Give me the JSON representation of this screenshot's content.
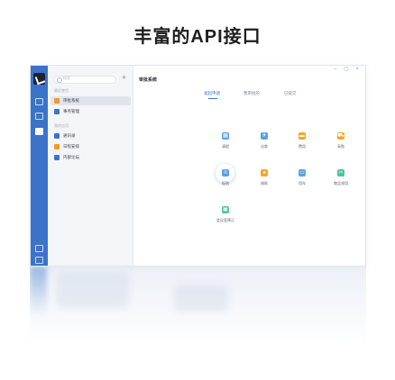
{
  "headline": "丰富的API接口",
  "sidebar": {
    "search_placeholder": "搜索",
    "add_label": "+",
    "group1_label": "最近使用",
    "group1_items": [
      {
        "label": "审批系统",
        "color": "#f29b1d",
        "active": true
      },
      {
        "label": "事务管理",
        "color": "#3b73c9",
        "active": false
      }
    ],
    "group2_label": "我的应用",
    "group2_items": [
      {
        "label": "通讯录",
        "color": "#3b73c9"
      },
      {
        "label": "日程安排",
        "color": "#f29b1d"
      },
      {
        "label": "内部论坛",
        "color": "#3b73c9"
      }
    ]
  },
  "main": {
    "title": "审批系统",
    "window_controls": "– ▢ ×",
    "tabs": [
      {
        "label": "发起申请",
        "active": true
      },
      {
        "label": "我审批的",
        "active": false
      },
      {
        "label": "已提交",
        "active": false
      }
    ],
    "apps": [
      {
        "label": "请假",
        "icon": "calendar-icon",
        "glyph": "▦",
        "color": "#5aa0e8"
      },
      {
        "label": "出差",
        "icon": "plane-icon",
        "glyph": "✈",
        "color": "#5aa0e8"
      },
      {
        "label": "费用",
        "icon": "wallet-icon",
        "glyph": "▬",
        "color": "#f5a623"
      },
      {
        "label": "采购",
        "icon": "cart-icon",
        "glyph": "⛟",
        "color": "#f5a623"
      },
      {
        "label": "报销",
        "icon": "receipt-icon",
        "glyph": "≡",
        "color": "#5aa0e8",
        "highlight": true
      },
      {
        "label": "借款",
        "icon": "coin-icon",
        "glyph": "●",
        "color": "#f5a623"
      },
      {
        "label": "用车",
        "icon": "car-icon",
        "glyph": "▭",
        "color": "#5aa0e8"
      },
      {
        "label": "物品领用",
        "icon": "box-icon",
        "glyph": "✂",
        "color": "#4cc2a0"
      },
      {
        "label": "会议室预订",
        "icon": "meeting-room-icon",
        "glyph": "▣",
        "color": "#4cc2a0"
      }
    ]
  }
}
